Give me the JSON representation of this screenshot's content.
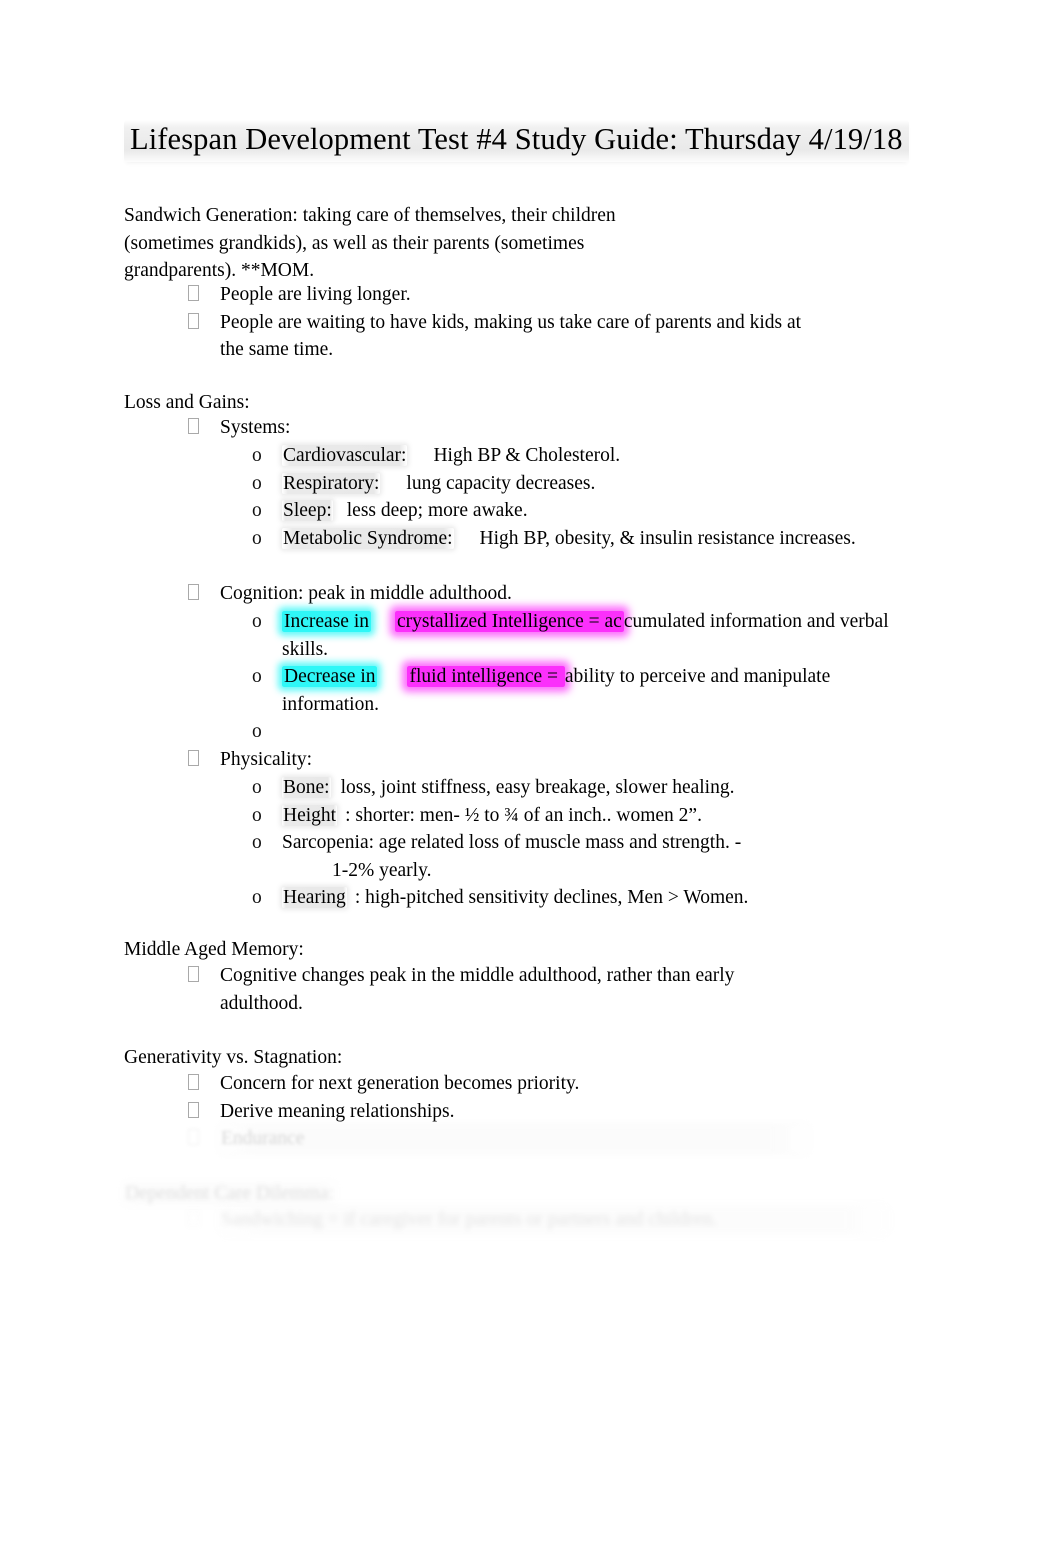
{
  "document": {
    "title": "Lifespan Development Test #4 Study Guide: Thursday 4/19/18",
    "page_background": "#ffffff",
    "text_color": "#000000"
  },
  "colors": {
    "highlight_cyan": "#2ff7f7",
    "highlight_magenta": "#fb30fb",
    "highlight_gray": "#eaeaea",
    "bullet_gray": "#a9a9a9"
  },
  "sections": {
    "sandwich": {
      "paragraph_line1": "Sandwich Generation: taking care of themselves, their children",
      "paragraph_line2": "(sometimes grandkids), as well as their parents (sometimes",
      "paragraph_line3": "grandparents). **MOM.",
      "bullets": [
        "People are living longer.",
        "People are waiting to have kids, making us take care of parents and kids at the same time."
      ]
    },
    "loss_and_gains": {
      "heading": "Loss and Gains:",
      "systems": {
        "label": "Systems:",
        "items": [
          {
            "term": "Cardiovascular:",
            "rest": "High BP & Cholesterol."
          },
          {
            "term": "Respiratory:",
            "rest": "lung capacity decreases."
          },
          {
            "term": "Sleep:",
            "rest": "less deep; more awake."
          },
          {
            "term": "Metabolic Syndrome:",
            "rest": "High BP, obesity, & insulin resistance increases."
          }
        ]
      },
      "cognition": {
        "label": "Cognition: peak in middle adulthood.",
        "increase_cyan": "Increase in",
        "increase_magenta": "crystallized Intelligence = ac",
        "increase_rest": "cumulated information and verbal skills.",
        "decrease_cyan": "Decrease in",
        "decrease_magenta": "fluid intelligence = ",
        "decrease_rest": "ability to perceive and manipulate information.",
        "empty_bullet": ""
      },
      "physicality": {
        "label": "Physicality:",
        "items": [
          {
            "term": "Bone:",
            "rest": "loss, joint stiffness, easy breakage, slower healing."
          },
          {
            "term": "Height",
            "rest": ": shorter: men- ½ to ¾ of an inch.. women 2”."
          },
          {
            "term": "Sarcopenia: age related loss of muscle mass and strength. -",
            "rest": "1-2% yearly."
          },
          {
            "term": "Hearing",
            "rest": ": high-pitched sensitivity declines, Men > Women."
          }
        ]
      }
    },
    "middle_aged_memory": {
      "heading": "Middle Aged Memory:",
      "bullets": [
        "Cognitive changes peak in the middle adulthood, rather than early adulthood."
      ]
    },
    "generativity": {
      "heading": "Generativity vs. Stagnation:",
      "bullets": [
        "Concern for next generation becomes priority.",
        "Derive meaning relationships.",
        "Endurance"
      ]
    },
    "dependent_care": {
      "heading": "Dependent Care Dilemma:",
      "bullets": [
        "Sandwiching = if caregiver for parents or partners and children."
      ]
    }
  }
}
